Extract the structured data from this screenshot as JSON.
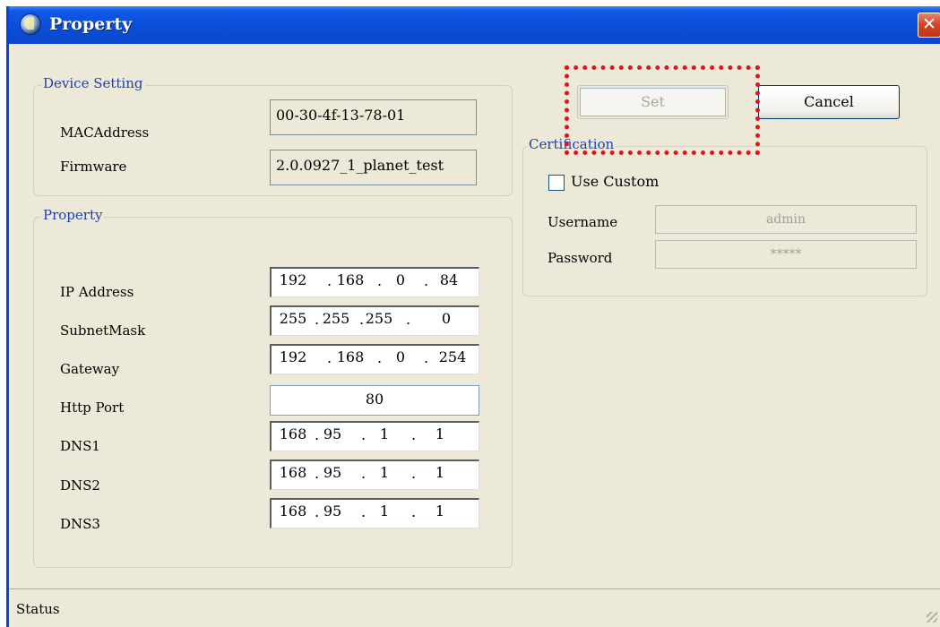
{
  "window": {
    "title": "Property",
    "close_icon": "close-icon"
  },
  "device_setting": {
    "legend": "Device Setting",
    "mac_label": "MACAddress",
    "mac_value": "00-30-4f-13-78-01",
    "firmware_label": "Firmware",
    "firmware_value": "2.0.0927_1_planet_test"
  },
  "property": {
    "legend": "Property",
    "ip_label": "IP Address",
    "ip": [
      "192",
      "168",
      "0",
      "84"
    ],
    "subnet_label": "SubnetMask",
    "subnet": [
      "255",
      "255",
      "255",
      "0"
    ],
    "gateway_label": "Gateway",
    "gateway": [
      "192",
      "168",
      "0",
      "254"
    ],
    "http_label": "Http Port",
    "http_port": "80",
    "dns1_label": "DNS1",
    "dns1": [
      "168",
      "95",
      "1",
      "1"
    ],
    "dns2_label": "DNS2",
    "dns2": [
      "168",
      "95",
      "1",
      "1"
    ],
    "dns3_label": "DNS3",
    "dns3": [
      "168",
      "95",
      "1",
      "1"
    ],
    "dot": "."
  },
  "buttons": {
    "set": "Set",
    "cancel": "Cancel"
  },
  "certification": {
    "legend": "Certification",
    "use_custom": "Use Custom",
    "username_label": "Username",
    "username_value": "admin",
    "password_label": "Password",
    "password_value": "*****"
  },
  "status": {
    "text": "Status"
  },
  "colors": {
    "title_bar": "#0b4ed8",
    "highlight": "#e0141b",
    "legend_text": "#1d3fae"
  }
}
